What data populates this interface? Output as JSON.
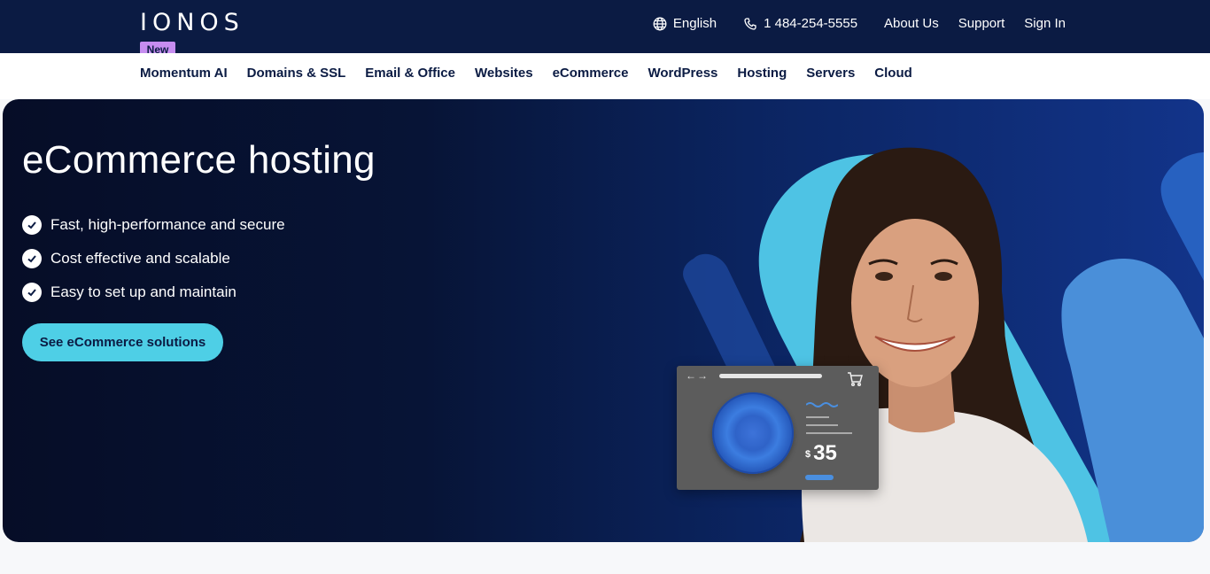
{
  "brand": {
    "logo": "IONOS",
    "badge": "New"
  },
  "topbar": {
    "language": "English",
    "phone": "1 484-254-5555",
    "links": [
      "About Us",
      "Support",
      "Sign In"
    ]
  },
  "nav": {
    "items": [
      "Momentum AI",
      "Domains & SSL",
      "Email & Office",
      "Websites",
      "eCommerce",
      "WordPress",
      "Hosting",
      "Servers",
      "Cloud"
    ]
  },
  "hero": {
    "title": "eCommerce hosting",
    "bullets": [
      "Fast, high-performance and secure",
      "Cost effective and scalable",
      "Easy to set up and maintain"
    ],
    "cta": "See eCommerce solutions"
  },
  "product_card": {
    "currency": "$",
    "price": "35"
  },
  "colors": {
    "navy": "#0b1b43",
    "accent": "#4ecfe6",
    "badge": "#c68df0"
  },
  "icons": [
    "globe-icon",
    "phone-icon",
    "check-icon",
    "cart-icon"
  ]
}
